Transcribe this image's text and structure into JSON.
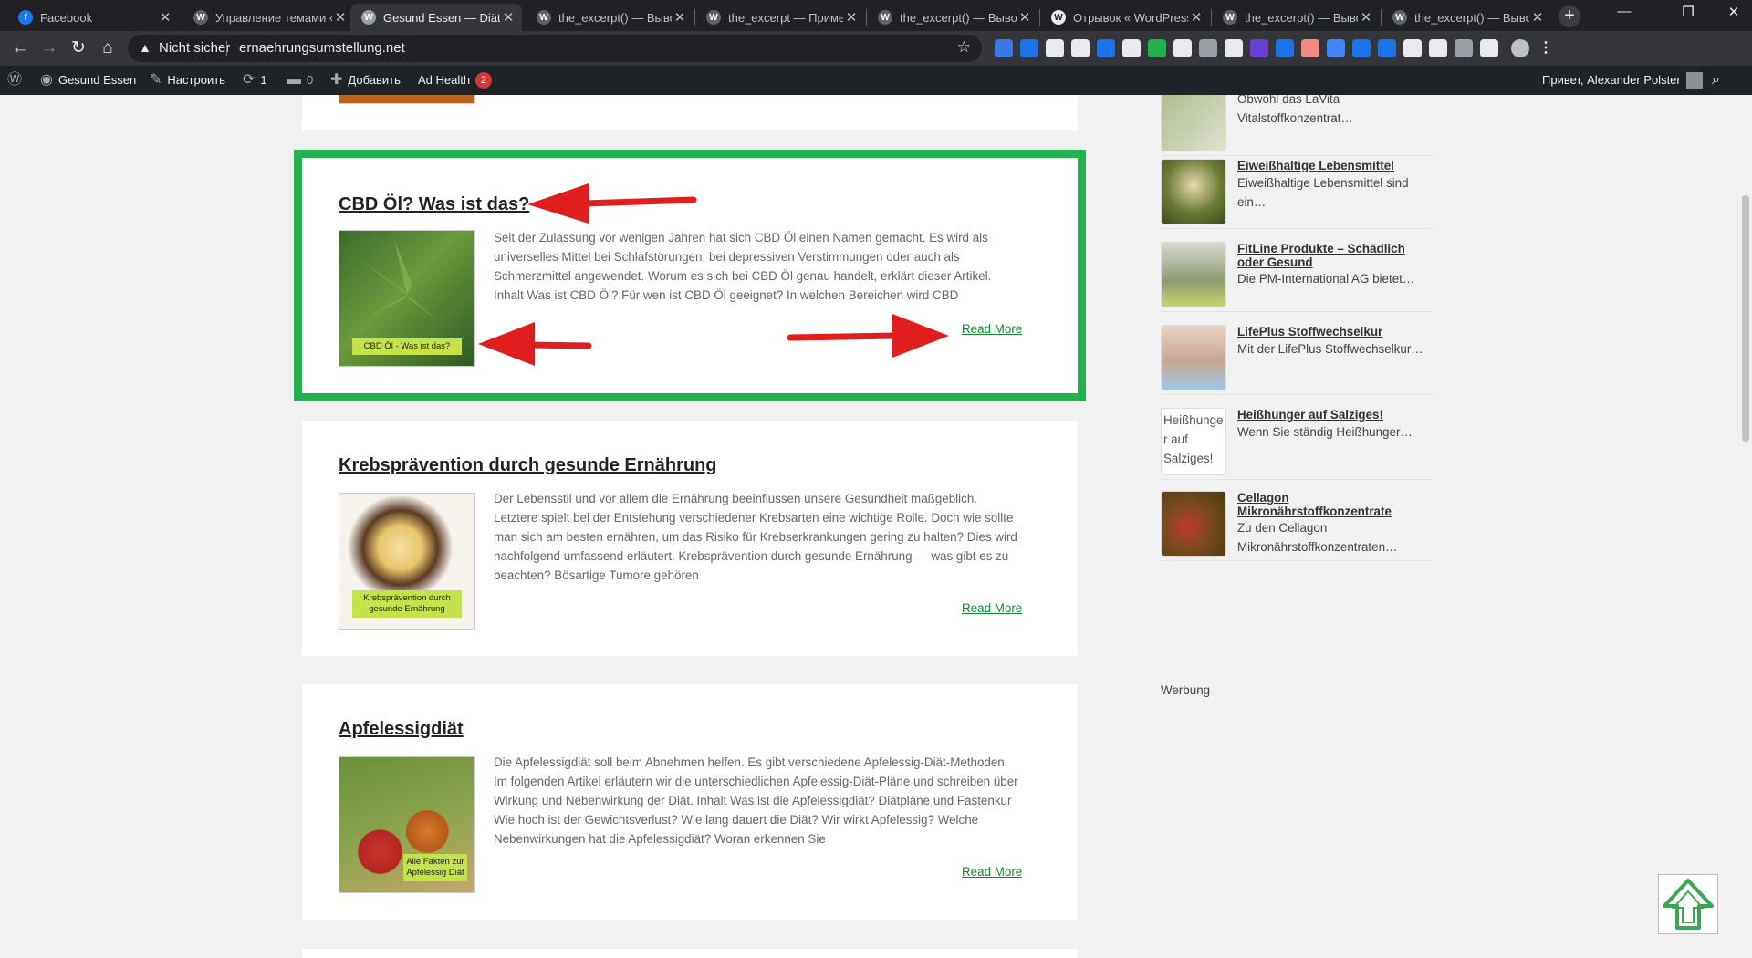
{
  "tabs": [
    {
      "title": "Facebook",
      "icon": "facebook-icon",
      "color": "#1877f2",
      "glyph": "f"
    },
    {
      "title": "Управление темами ‹",
      "icon": "wordpress-icon",
      "color": "#5f6368",
      "glyph": "W"
    },
    {
      "title": "Gesund Essen — Diäter",
      "icon": "wordpress-icon",
      "color": "#9aa0a6",
      "glyph": "W",
      "active": true
    },
    {
      "title": "the_excerpt() — Вывод",
      "icon": "wordpress-icon",
      "color": "#5f6368",
      "glyph": "W"
    },
    {
      "title": "the_excerpt — Примен",
      "icon": "wordpress-icon",
      "color": "#5f6368",
      "glyph": "W"
    },
    {
      "title": "the_excerpt() — Вывод",
      "icon": "wordpress-icon",
      "color": "#5f6368",
      "glyph": "W"
    },
    {
      "title": "Отрывок « WordPress",
      "icon": "wordpress-icon",
      "color": "#e8eaed",
      "glyph": "W"
    },
    {
      "title": "the_excerpt() — Вывод",
      "icon": "wordpress-icon",
      "color": "#5f6368",
      "glyph": "W"
    },
    {
      "title": "the_excerpt() — Вывод",
      "icon": "wordpress-icon",
      "color": "#5f6368",
      "glyph": "W"
    }
  ],
  "address": {
    "security": "Nicht sicher",
    "url": "ernaehrungsumstellung.net"
  },
  "extensions": [
    "#3b78e7",
    "#1a73e8",
    "#e8eaed",
    "#e8eaed",
    "#1a73e8",
    "#e8eaed",
    "#23b14d",
    "#e8eaed",
    "#9aa0a6",
    "#e8eaed",
    "#6a3fd4",
    "#1a73e8",
    "#f28b82",
    "#4285f4",
    "#1a73e8",
    "#1a73e8",
    "#e8eaed",
    "#e8eaed",
    "#9aa0a6",
    "#e8eaed"
  ],
  "adminbar": {
    "site": "Gesund Essen",
    "customize": "Настроить",
    "updates": "1",
    "comments": "0",
    "add": "Добавить",
    "ad_health": "Ad Health",
    "ad_health_count": "2",
    "greeting": "Привет, Alexander Polster"
  },
  "posts": [
    {
      "title": "CBD Öl? Was ist das?",
      "thumb_label": "CBD Öl - Was ist das?",
      "excerpt": "Seit der Zulassung vor wenigen Jahren hat sich CBD Öl einen Namen gemacht. Es wird als universelles Mittel bei Schlafstörungen, bei depressiven Verstimmungen oder auch als Schmerzmittel angewendet. Worum es sich bei CBD Öl genau handelt, erklärt dieser Artikel. Inhalt Was ist CBD Öl? Für wen ist CBD Öl geeignet? In welchen Bereichen wird CBD",
      "read_more": "Read More"
    },
    {
      "title": "Krebsprävention durch gesunde Ernährung",
      "thumb_label": "Krebsprävention durch gesunde Ernährung",
      "excerpt": "Der Lebensstil und vor allem die Ernährung beeinflussen unsere Gesundheit maßgeblich. Letztere spielt bei der Entstehung verschiedener Krebsarten eine wichtige Rolle. Doch wie sollte man sich am besten ernähren, um das Risiko für Krebserkrankungen gering zu halten? Dies wird nachfolgend umfassend erläutert. Krebsprävention durch gesunde Ernährung — was gibt es zu beachten? Bösartige Tumore gehören",
      "read_more": "Read More"
    },
    {
      "title": "Apfelessigdiät",
      "thumb_label": "Alle Fakten zur Apfelessig Diät",
      "excerpt": "Die Apfelessigdiät soll beim Abnehmen helfen. Es gibt verschiedene Apfelessig-Diät-Methoden. Im folgenden Artikel erläutern wir die unterschiedlichen Apfelessig-Diät-Pläne und schreiben über Wirkung und Nebenwirkung der Diät. Inhalt Was ist die Apfelessigdiät? Diätpläne und Fastenkur Wie hoch ist der Gewichtsverlust? Wie lang dauert die Diät? Wir wirkt Apfelessig? Welche Nebenwirkungen hat die Apfelessigdiät? Woran erkennen Sie",
      "read_more": "Read More"
    }
  ],
  "sidebar": [
    {
      "title": "",
      "excerpt_top": "Obwohl das LaVita",
      "excerpt": "Vitalstoffkonzentrat…"
    },
    {
      "title": "Eiweißhaltige Lebensmittel",
      "excerpt": "Eiweißhaltige Lebensmittel sind ein…"
    },
    {
      "title": "FitLine Produkte – Schädlich oder Gesund",
      "excerpt": "Die PM-International AG bietet…"
    },
    {
      "title": "LifePlus Stoffwechselkur",
      "excerpt": "Mit der LifePlus Stoffwechselkur…"
    },
    {
      "title": "Heißhunger auf Salziges!",
      "excerpt": "Wenn Sie ständig Heißhunger…",
      "alt": "Heißhunger auf Salziges!"
    },
    {
      "title": "Cellagon Mikronährstoffkonzentrate",
      "excerpt": "Zu den Cellagon Mikronährstoffkonzentraten…"
    }
  ],
  "werbung": "Werbung",
  "colors": {
    "highlight": "#23b14d",
    "link_green": "#128a2f",
    "arrow_red": "#e01e1e"
  }
}
